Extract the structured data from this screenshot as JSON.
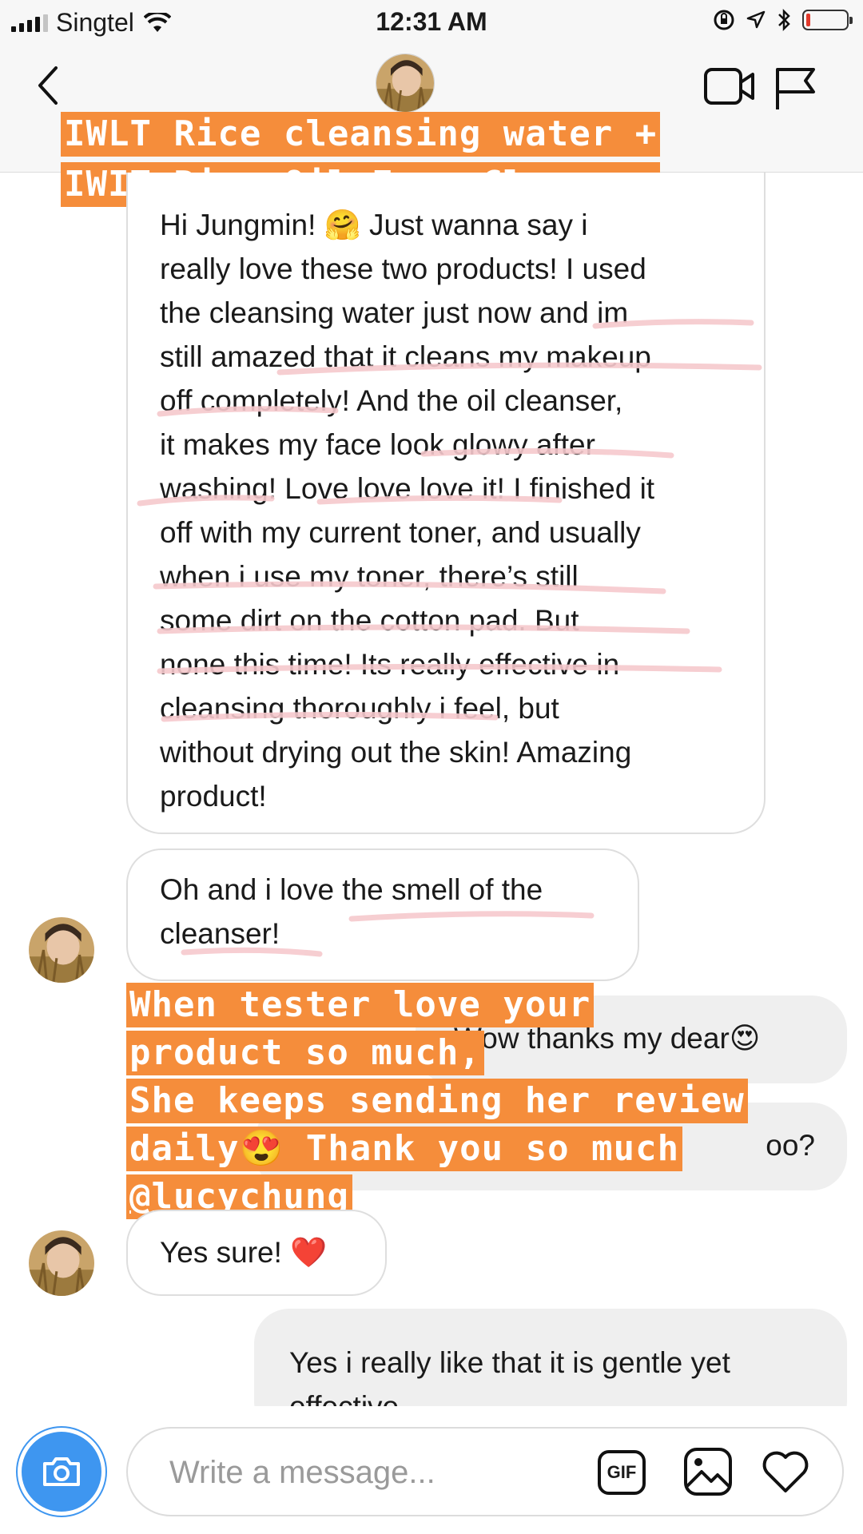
{
  "status_bar": {
    "carrier": "Singtel",
    "time": "12:31 AM",
    "battery_level": 0.1
  },
  "header": {
    "icons": [
      "back-chevron-icon",
      "video-call-icon",
      "flag-icon"
    ]
  },
  "stickers": {
    "top_lines": [
      "IWLT Rice cleansing water +",
      "IWIT Rice Oil Foam Cleanser"
    ],
    "middle_lines": [
      "When tester love your",
      "product so much,",
      "She keeps sending her review",
      "daily😍 Thank you so much",
      "@lucychung"
    ]
  },
  "messages": [
    {
      "direction": "received",
      "text": "Hi Jungmin! 🤗 Just wanna say i\nreally love these two products! I used\nthe cleansing water just now and im\nstill amazed that it cleans my makeup\noff completely! And the oil cleanser,\nit makes my face look glowy after\nwashing! Love love love it! I finished it\noff with my current toner, and usually\nwhen i use my toner, there’s still\nsome dirt on the cotton pad. But\nnone this time! Its really effective in\ncleansing thoroughly i feel, but\nwithout drying out the skin! Amazing\nproduct!"
    },
    {
      "direction": "received",
      "text": "Oh and i love the smell of the\ncleanser!"
    },
    {
      "direction": "sent",
      "text": "Wow thanks my dear😍"
    },
    {
      "direction": "sent",
      "text": "oo?"
    },
    {
      "direction": "received",
      "text": "Yes sure! ❤️"
    },
    {
      "direction": "sent",
      "text": "Yes i  really like that it is gentle yet\neffective"
    }
  ],
  "composer": {
    "placeholder": "Write a message...",
    "gif_label": "GIF",
    "icons": [
      "camera-icon",
      "gallery-icon",
      "heart-icon"
    ]
  },
  "colors": {
    "sticker_orange": "#f58d3b",
    "camera_blue": "#3e96f0",
    "underline_pink": "#f6c9cd",
    "sent_bubble": "#efefef"
  }
}
